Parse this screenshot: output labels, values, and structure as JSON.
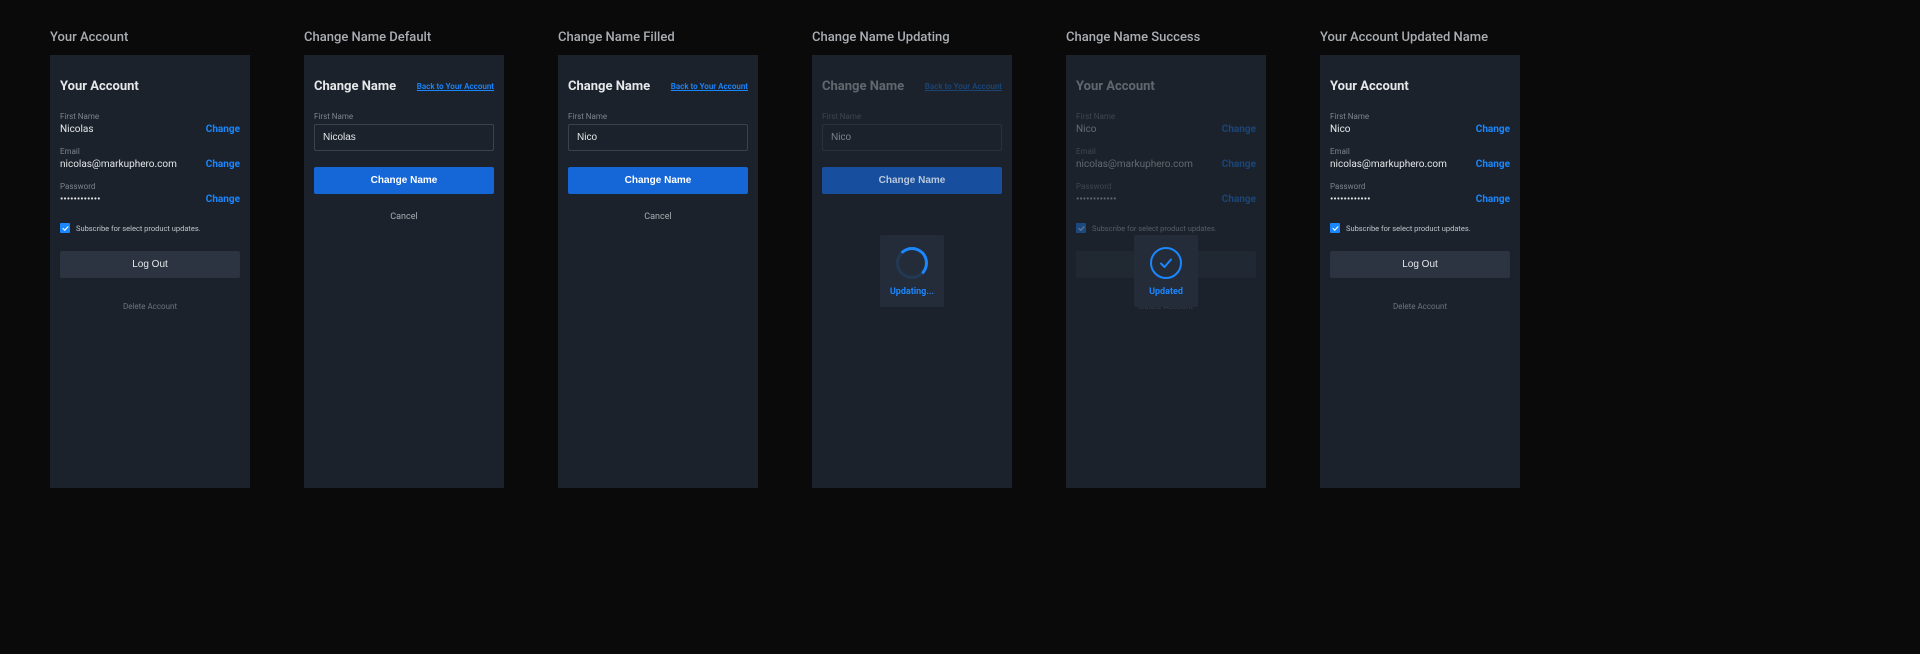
{
  "labels": {
    "first_name": "First Name",
    "email": "Email",
    "password": "Password",
    "change": "Change",
    "change_name_btn": "Change Name",
    "cancel": "Cancel",
    "back": "Back to Your Account",
    "subscribe": "Subscribe for select product updates.",
    "logout": "Log Out",
    "delete": "Delete Account",
    "updating": "Updating...",
    "updated": "Updated"
  },
  "cols": [
    {
      "title": "Your Account",
      "heading": "Your Account",
      "first_name_value": "Nicolas",
      "email_value": "nicolas@markuphero.com",
      "password_value": "••••••••••••"
    },
    {
      "title": "Change Name Default",
      "heading": "Change Name",
      "input_value": "Nicolas"
    },
    {
      "title": "Change Name Filled",
      "heading": "Change Name",
      "input_value": "Nico"
    },
    {
      "title": "Change Name Updating",
      "heading": "Change Name",
      "input_value": "Nico"
    },
    {
      "title": "Change Name Success",
      "heading": "Your Account",
      "first_name_value": "Nico",
      "email_value": "nicolas@markuphero.com",
      "password_value": "••••••••••••"
    },
    {
      "title": "Your Account Updated Name",
      "heading": "Your Account",
      "first_name_value": "Nico",
      "email_value": "nicolas@markuphero.com",
      "password_value": "••••••••••••"
    }
  ]
}
